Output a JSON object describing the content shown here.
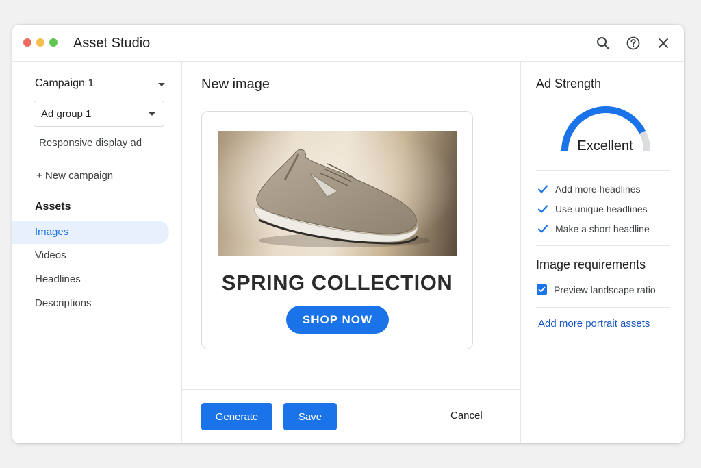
{
  "window": {
    "title": "Asset Studio",
    "icons": [
      "search-icon",
      "help-icon",
      "close-icon"
    ]
  },
  "sidebar": {
    "campaign": "Campaign 1",
    "ad_group": "Ad group 1",
    "ad_type": "Responsive display ad",
    "new_campaign": "+ New campaign",
    "assets_heading": "Assets",
    "items": [
      {
        "label": "Images",
        "active": true
      },
      {
        "label": "Videos",
        "active": false
      },
      {
        "label": "Headlines",
        "active": false
      },
      {
        "label": "Descriptions",
        "active": false
      }
    ]
  },
  "main": {
    "title": "New image",
    "ad_preview": {
      "headline": "SPRING COLLECTION",
      "cta": "SHOP NOW"
    },
    "buttons": {
      "generate": "Generate",
      "save": "Save",
      "cancel": "Cancel"
    }
  },
  "right_panel": {
    "strength_title": "Ad Strength",
    "strength_value": "Excellent",
    "strength_level": 0.85,
    "checklist": [
      "Add more headlines",
      "Use unique headlines",
      "Make a short headline"
    ],
    "requirements_title": "Image requirements",
    "preview_checkbox": {
      "label": "Preview landscape ratio",
      "checked": true
    },
    "portrait_link": "Add more portrait assets"
  },
  "colors": {
    "accent": "#1a73e8",
    "link": "#1a56c2",
    "active_nav_bg": "#e8f0fe",
    "gauge_track": "#dadce0"
  }
}
